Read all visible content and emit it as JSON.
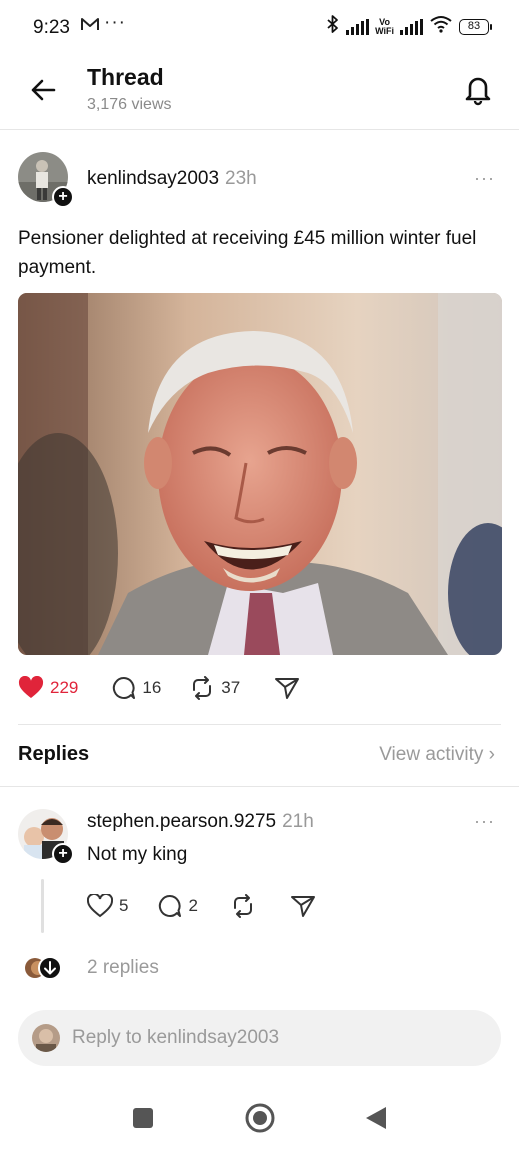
{
  "status_bar": {
    "time": "9:23",
    "dots": "···",
    "vowifi": [
      "Vo",
      "WiFi"
    ],
    "battery": "83"
  },
  "header": {
    "title": "Thread",
    "views": "3,176 views"
  },
  "post": {
    "username": "kenlindsay2003",
    "time": "23h",
    "more": "···",
    "text": "Pensioner delighted at receiving £45 million winter fuel payment.",
    "likes": "229",
    "comments": "16",
    "reposts": "37"
  },
  "replies_section": {
    "title": "Replies",
    "view_activity": "View activity"
  },
  "reply": {
    "username": "stephen.pearson.9275",
    "time": "21h",
    "more": "···",
    "text": "Not my king",
    "likes": "5",
    "comments": "2",
    "more_replies": "2 replies"
  },
  "composer": {
    "placeholder": "Reply to kenlindsay2003"
  },
  "colors": {
    "like_red": "#e0243a",
    "muted": "#9a9a9a"
  }
}
